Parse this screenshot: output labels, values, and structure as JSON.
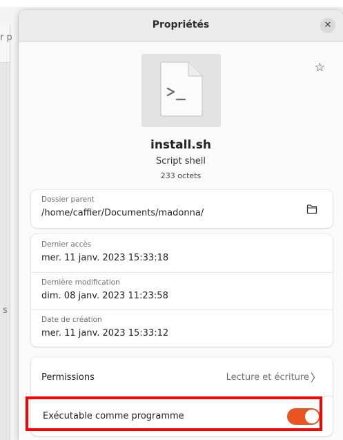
{
  "dialog": {
    "title": "Propriétés",
    "close_icon": "close-icon",
    "star_icon": "star-icon"
  },
  "file": {
    "name": "install.sh",
    "type": "Script shell",
    "size": "233 octets",
    "icon": "script-file-icon"
  },
  "parent": {
    "label": "Dossier parent",
    "path": "/home/caffier/Documents/madonna/",
    "icon": "folder-icon"
  },
  "dates": [
    {
      "label": "Dernier accès",
      "value": "mer. 11 janv. 2023 15:33:18"
    },
    {
      "label": "Dernière modification",
      "value": "dim. 08 janv. 2023 11:23:58"
    },
    {
      "label": "Date de création",
      "value": "mer. 11 janv. 2023 15:33:12"
    }
  ],
  "permissions": {
    "label": "Permissions",
    "value": "Lecture et écriture",
    "chevron": "chevron-right-icon"
  },
  "executable": {
    "label": "Exécutable comme programme",
    "enabled": true,
    "toggle_color": "#e95420"
  },
  "highlight_color": "#ff0000"
}
